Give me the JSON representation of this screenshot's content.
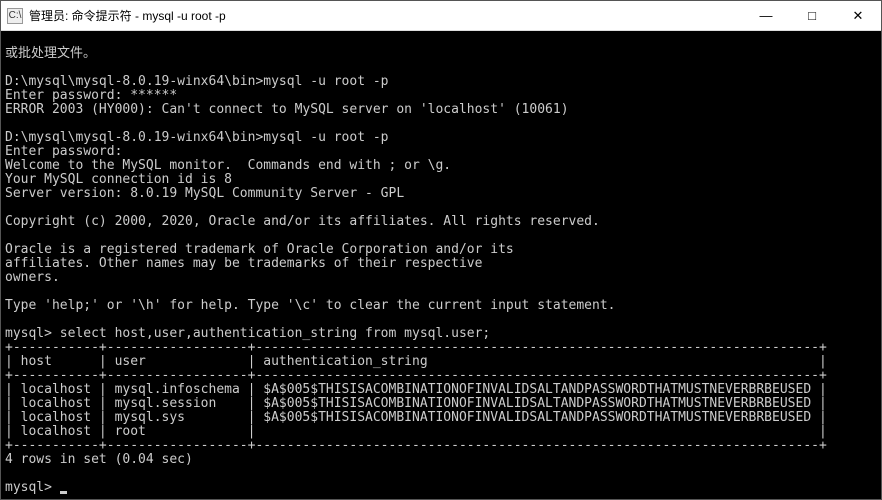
{
  "window": {
    "title": "管理员: 命令提示符 - mysql  -u root -p",
    "icon_glyph": "C:\\",
    "buttons": {
      "min": "—",
      "max": "□",
      "close": "✕"
    }
  },
  "terminal": {
    "lines": [
      "或批处理文件。",
      "",
      "D:\\mysql\\mysql-8.0.19-winx64\\bin>mysql -u root -p",
      "Enter password: ******",
      "ERROR 2003 (HY000): Can't connect to MySQL server on 'localhost' (10061)",
      "",
      "D:\\mysql\\mysql-8.0.19-winx64\\bin>mysql -u root -p",
      "Enter password:",
      "Welcome to the MySQL monitor.  Commands end with ; or \\g.",
      "Your MySQL connection id is 8",
      "Server version: 8.0.19 MySQL Community Server - GPL",
      "",
      "Copyright (c) 2000, 2020, Oracle and/or its affiliates. All rights reserved.",
      "",
      "Oracle is a registered trademark of Oracle Corporation and/or its",
      "affiliates. Other names may be trademarks of their respective",
      "owners.",
      "",
      "Type 'help;' or '\\h' for help. Type '\\c' to clear the current input statement.",
      "",
      "mysql> select host,user,authentication_string from mysql.user;"
    ],
    "table": {
      "border_top": "+-----------+------------------+------------------------------------------------------------------------+",
      "header_row": "| host      | user             | authentication_string                                                  |",
      "border_mid": "+-----------+------------------+------------------------------------------------------------------------+",
      "rows": [
        "| localhost | mysql.infoschema | $A$005$THISISACOMBINATIONOFINVALIDSALTANDPASSWORDTHATMUSTNEVERBRBEUSED |",
        "| localhost | mysql.session    | $A$005$THISISACOMBINATIONOFINVALIDSALTANDPASSWORDTHATMUSTNEVERBRBEUSED |",
        "| localhost | mysql.sys        | $A$005$THISISACOMBINATIONOFINVALIDSALTANDPASSWORDTHATMUSTNEVERBRBEUSED |",
        "| localhost | root             |                                                                        |"
      ],
      "border_bot": "+-----------+------------------+------------------------------------------------------------------------+"
    },
    "footer": [
      "4 rows in set (0.04 sec)",
      "",
      "mysql> "
    ]
  }
}
